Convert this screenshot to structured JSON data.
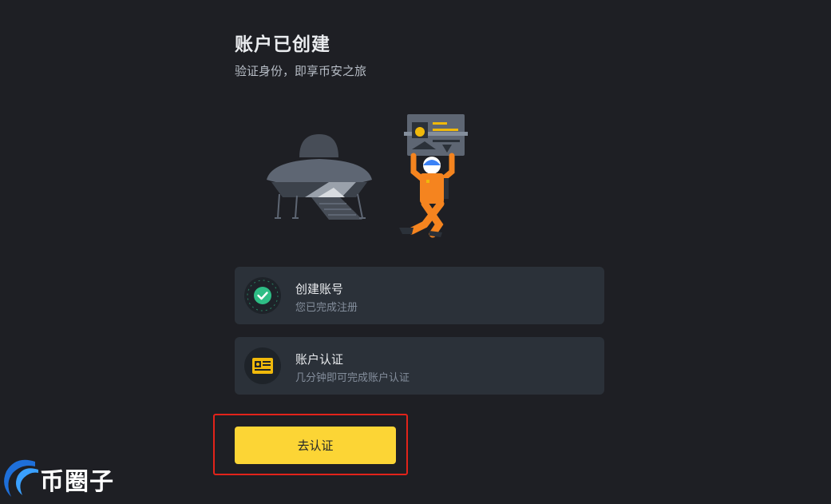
{
  "header": {
    "title": "账户已创建",
    "subtitle": "验证身份，即享币安之旅"
  },
  "steps": [
    {
      "title": "创建账号",
      "description": "您已完成注册",
      "icon": "check-circle-icon",
      "status": "completed"
    },
    {
      "title": "账户认证",
      "description": "几分钟即可完成账户认证",
      "icon": "id-card-icon",
      "status": "pending"
    }
  ],
  "cta": {
    "label": "去认证"
  },
  "watermark": {
    "text": "币圈子"
  },
  "colors": {
    "background": "#1e1f24",
    "card": "#2b3139",
    "accent": "#fcd535",
    "success": "#2ebd85",
    "highlight_border": "#e2231a"
  }
}
